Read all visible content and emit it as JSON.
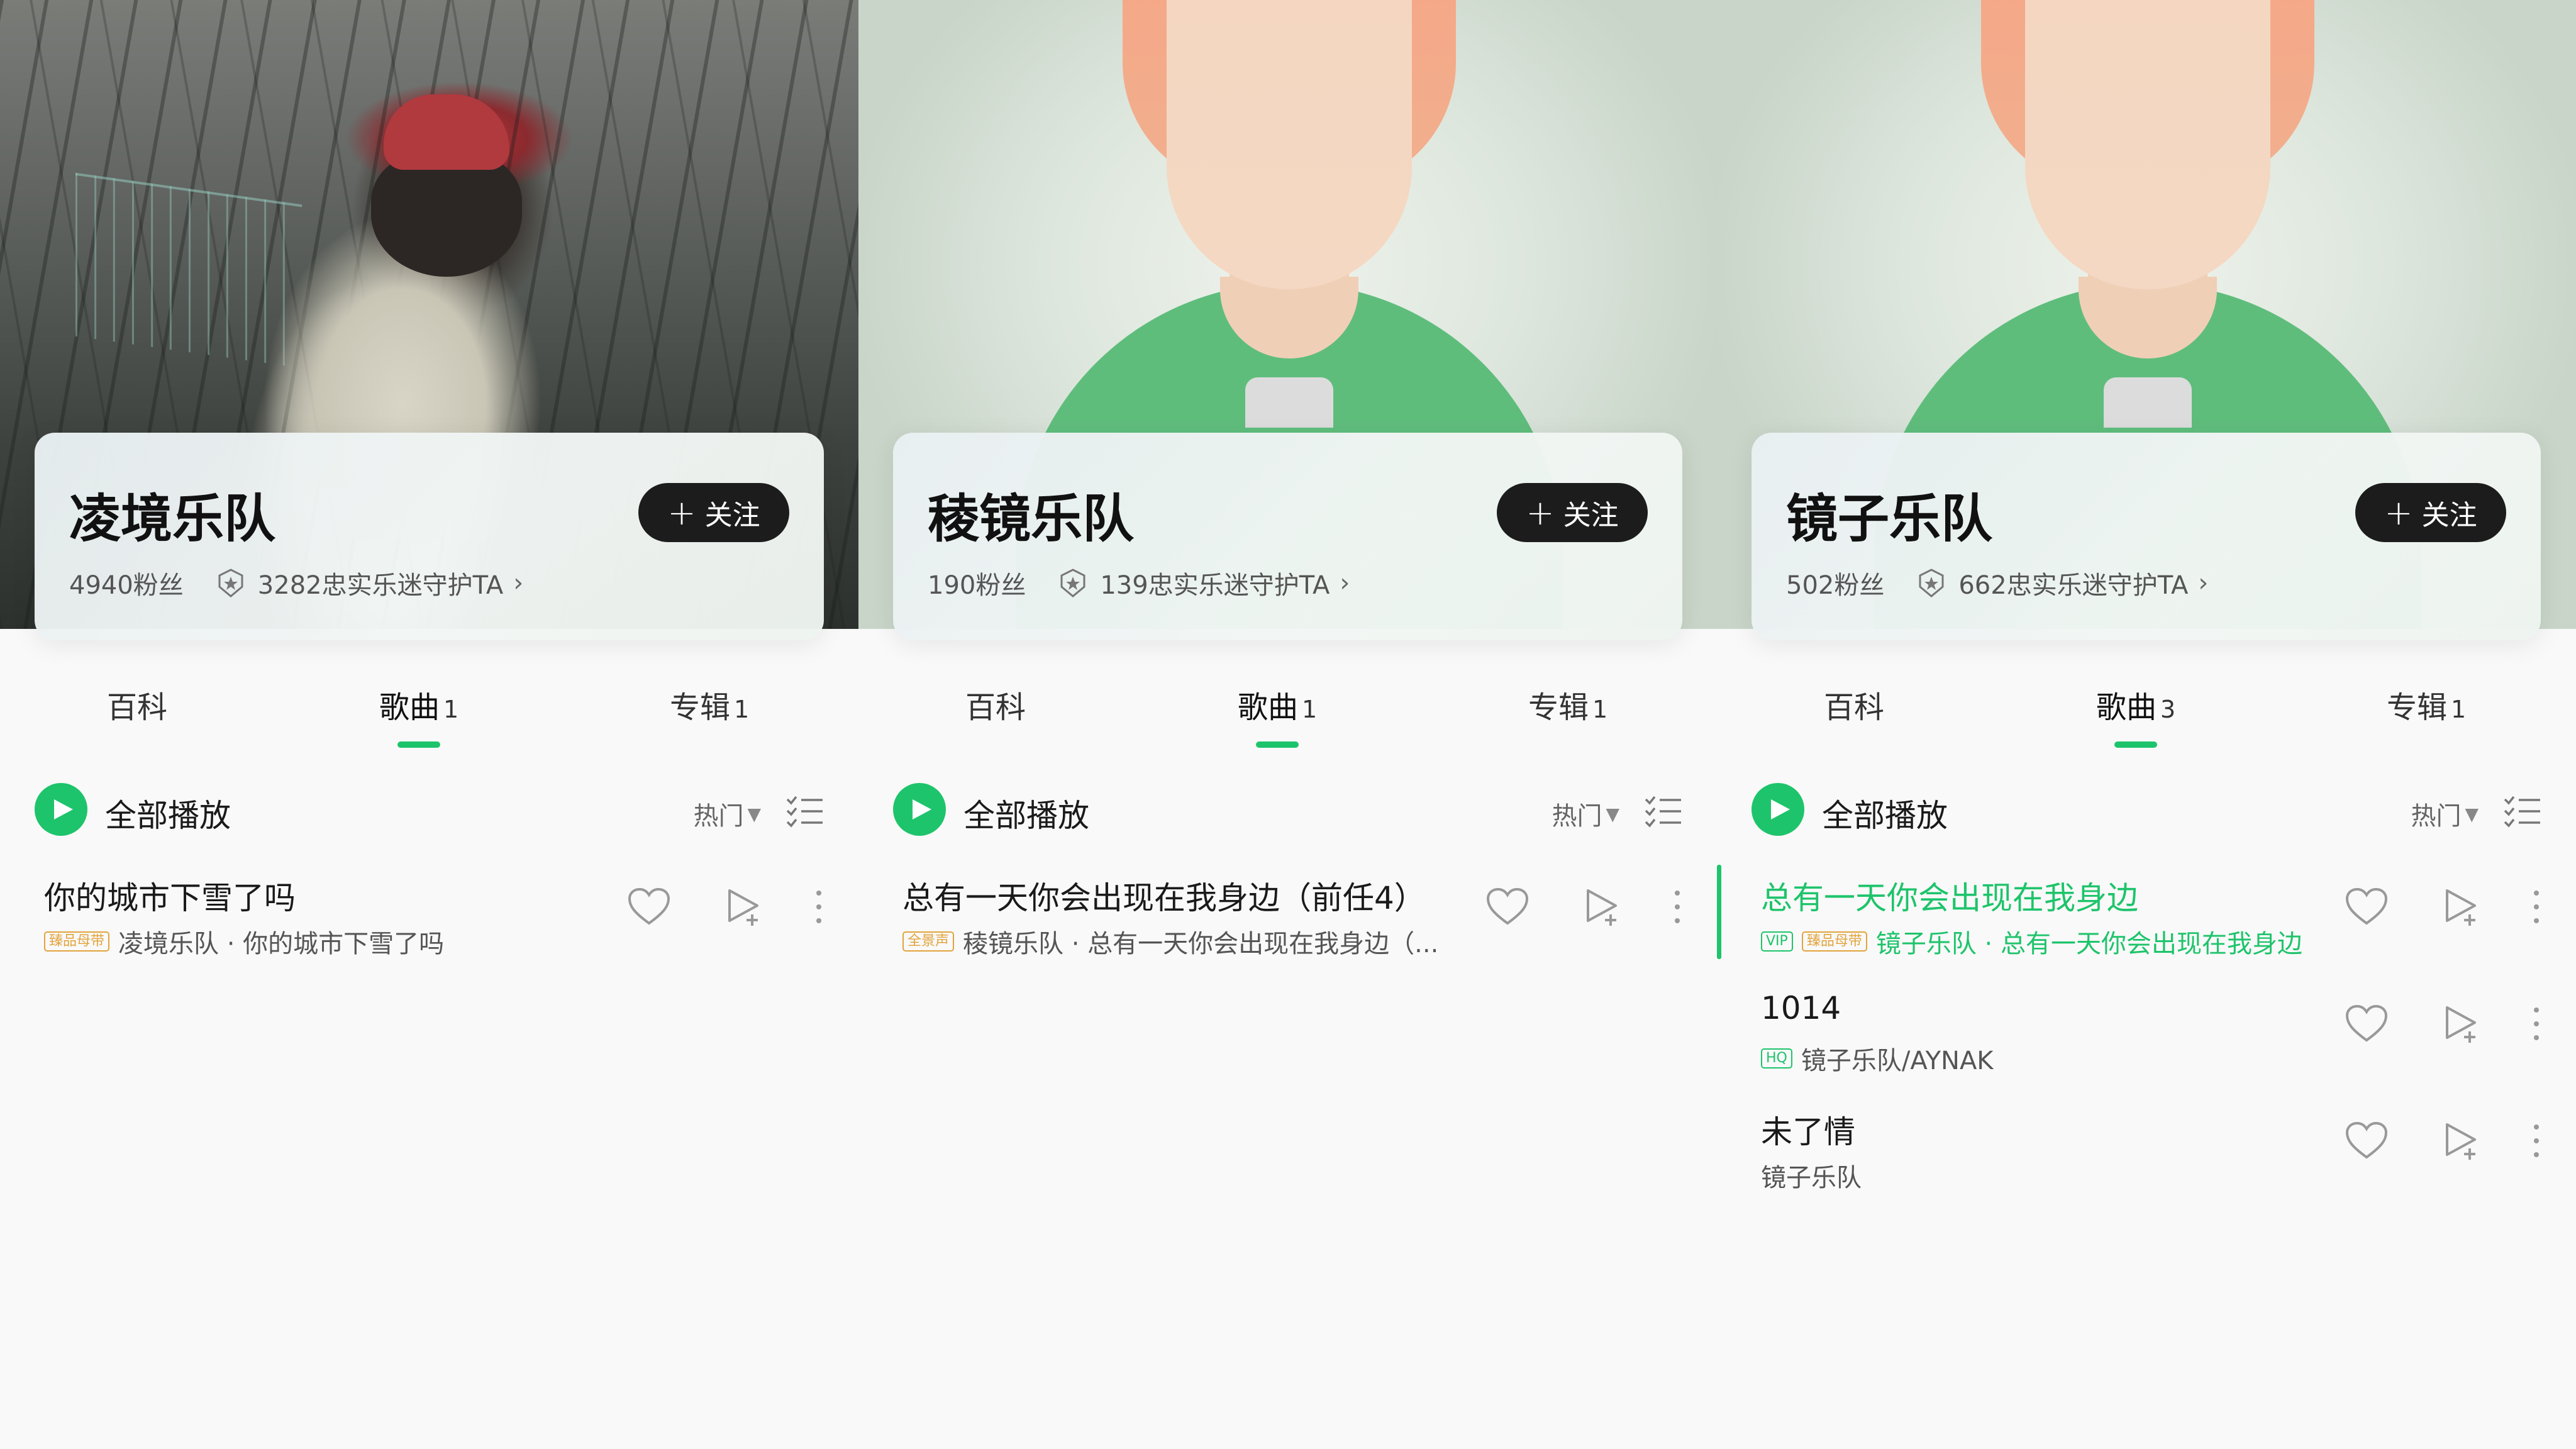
{
  "screens": [
    {
      "artist": "凌境乐队",
      "fans": "4940粉丝",
      "loyal": "3282忠实乐迷守护TA",
      "follow": "关注",
      "tabs": [
        {
          "label": "百科",
          "count": ""
        },
        {
          "label": "歌曲",
          "count": "1"
        },
        {
          "label": "专辑",
          "count": "1"
        }
      ],
      "play_all": "全部播放",
      "sort": "热门",
      "songs": [
        {
          "title": "你的城市下雪了吗",
          "badges": [
            "臻品母带"
          ],
          "meta": "凌境乐队 · 你的城市下雪了吗"
        }
      ]
    },
    {
      "artist": "稜镜乐队",
      "fans": "190粉丝",
      "loyal": "139忠实乐迷守护TA",
      "follow": "关注",
      "tabs": [
        {
          "label": "百科",
          "count": ""
        },
        {
          "label": "歌曲",
          "count": "1"
        },
        {
          "label": "专辑",
          "count": "1"
        }
      ],
      "play_all": "全部播放",
      "sort": "热门",
      "songs": [
        {
          "title": "总有一天你会出现在我身边（前任4）",
          "badges": [
            "全景声"
          ],
          "meta": "稜镜乐队 · 总有一天你会出现在我身边（..."
        }
      ]
    },
    {
      "artist": "镜子乐队",
      "fans": "502粉丝",
      "loyal": "662忠实乐迷守护TA",
      "follow": "关注",
      "tabs": [
        {
          "label": "百科",
          "count": ""
        },
        {
          "label": "歌曲",
          "count": "3"
        },
        {
          "label": "专辑",
          "count": "1"
        }
      ],
      "play_all": "全部播放",
      "sort": "热门",
      "songs": [
        {
          "title": "总有一天你会出现在我身边",
          "badges": [
            "VIP",
            "臻品母带"
          ],
          "meta": "镜子乐队 · 总有一天你会出现在我身边"
        },
        {
          "title": "1014",
          "badges": [
            "HQ"
          ],
          "meta": "镜子乐队/AYNAK"
        },
        {
          "title": "未了情",
          "badges": [],
          "meta": "镜子乐队"
        }
      ]
    }
  ],
  "colors": {
    "accent": "#1ec46b",
    "follow_bg": "#1c1c1c",
    "badge_gold": "#e2a43d"
  },
  "icons": [
    "play-icon",
    "shield-icon",
    "chevron-right-icon",
    "sort-caret-icon",
    "list-select-icon",
    "heart-icon",
    "add-to-playlist-icon",
    "more-icon"
  ]
}
